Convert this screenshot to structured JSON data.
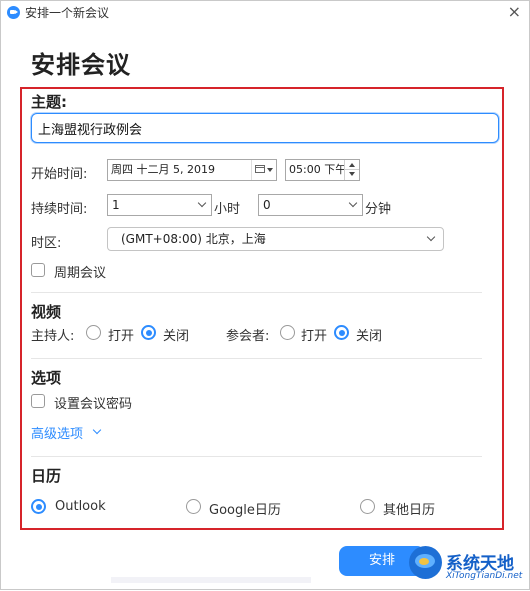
{
  "window": {
    "title": "安排一个新会议",
    "icon": "zoom-app-icon",
    "close_glyph": "×"
  },
  "heading": "安排会议",
  "topic": {
    "label": "主题:",
    "value": "上海盟视行政例会"
  },
  "start_time": {
    "label": "开始时间:",
    "date": "周四  十二月   5, 2019",
    "time": "05:00 下午"
  },
  "duration": {
    "label": "持续时间:",
    "hours": "1",
    "hours_unit": "小时",
    "minutes": "0",
    "minutes_unit": "分钟"
  },
  "timezone": {
    "label": "时区:",
    "value": "(GMT+08:00) 北京，上海"
  },
  "recurring": {
    "label": "周期会议",
    "checked": false
  },
  "video": {
    "title": "视频",
    "host_label": "主持人:",
    "participant_label": "参会者:",
    "on_label": "打开",
    "off_label": "关闭",
    "host_value": "关闭",
    "participant_value": "关闭"
  },
  "options": {
    "title": "选项",
    "password_label": "设置会议密码",
    "password_checked": false,
    "advanced_label": "高级选项"
  },
  "calendar": {
    "title": "日历",
    "items": [
      {
        "label": "Outlook",
        "selected": true
      },
      {
        "label": "Google日历",
        "selected": false
      },
      {
        "label": "其他日历",
        "selected": false
      }
    ]
  },
  "actions": {
    "schedule_label": "安排"
  },
  "watermark": {
    "title": "系统天地",
    "url": "XiTongTianDi.net"
  },
  "colors": {
    "accent": "#2d8cff",
    "highlight_frame": "#d6242a"
  }
}
